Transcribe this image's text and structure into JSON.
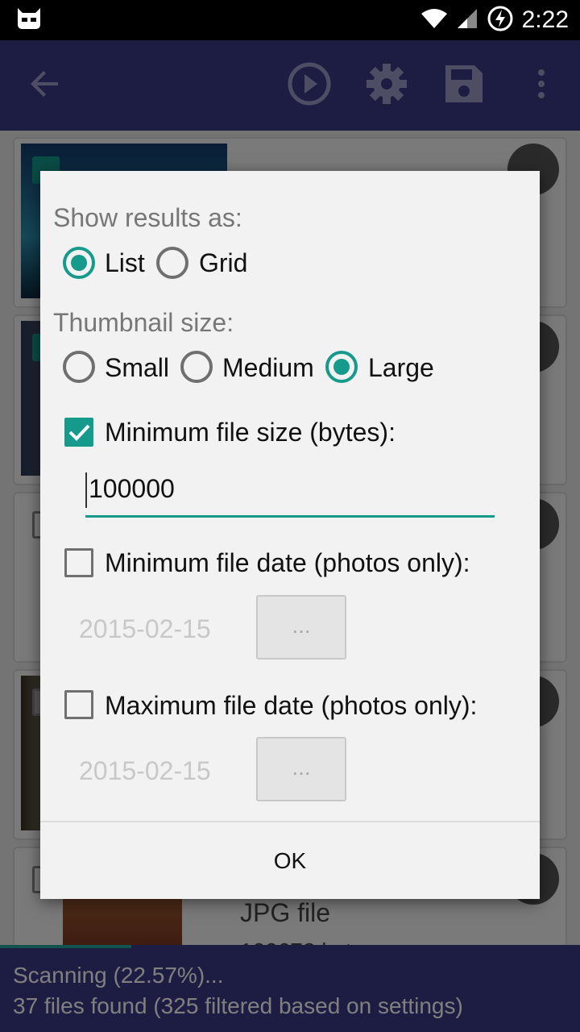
{
  "status_bar": {
    "time": "2:22"
  },
  "toolbar": {
    "back_icon": "arrow-back-icon",
    "play_icon": "play-circle-icon",
    "settings_icon": "gear-icon",
    "save_icon": "floppy-disk-icon",
    "overflow_icon": "more-vert-icon"
  },
  "list": {
    "visible_item": {
      "type": "JPG file",
      "size_partial": "100672 byt"
    }
  },
  "dialog": {
    "show_results_label": "Show results as:",
    "show_results_options": [
      "List",
      "Grid"
    ],
    "show_results_selected": "List",
    "thumbnail_size_label": "Thumbnail size:",
    "thumbnail_options": [
      "Small",
      "Medium",
      "Large"
    ],
    "thumbnail_selected": "Large",
    "min_size": {
      "label": "Minimum file size (bytes):",
      "checked": true,
      "value": "100000"
    },
    "min_date": {
      "label": "Minimum file date (photos only):",
      "checked": false,
      "date": "2015-02-15",
      "button": "..."
    },
    "max_date": {
      "label": "Maximum file date (photos only):",
      "checked": false,
      "date": "2015-02-15",
      "button": "..."
    },
    "ok_label": "OK"
  },
  "scan": {
    "progress_text": "Scanning (22.57%)...",
    "progress_percent": 22.57,
    "files_text": "37 files found (325 filtered based on settings)"
  },
  "colors": {
    "primary": "#3a3a86",
    "accent": "#159a8c"
  }
}
